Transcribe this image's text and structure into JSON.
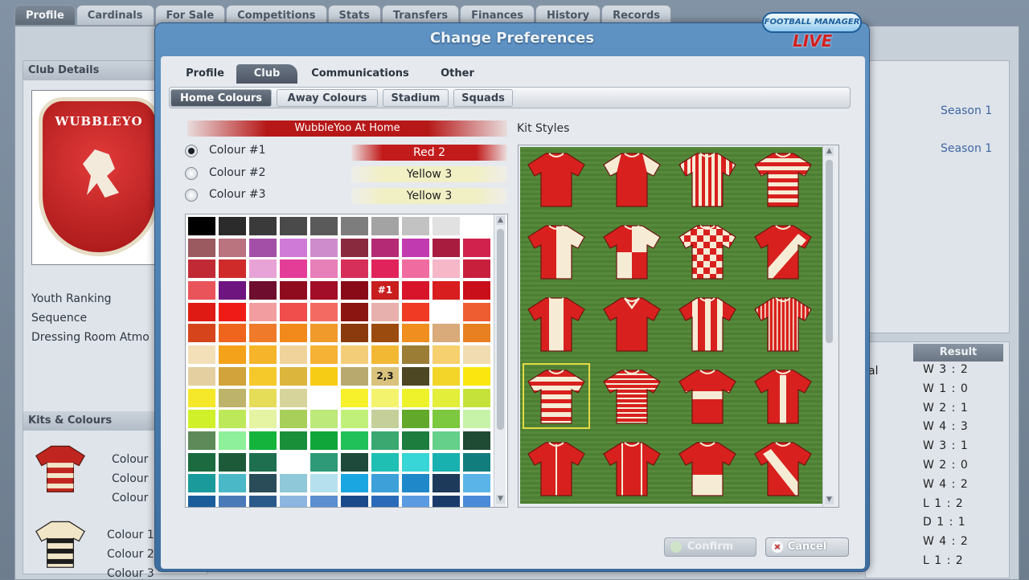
{
  "background": {
    "top_tabs": [
      "Profile",
      "Cardinals",
      "For Sale",
      "Competitions",
      "Stats",
      "Transfers",
      "Finances",
      "History",
      "Records"
    ],
    "left_panel": {
      "club_details_title": "Club Details",
      "crest_text": "WUBBLEYO",
      "labels": [
        "Youth Ranking",
        "Sequence",
        "Dressing Room Atmo"
      ],
      "kits_title": "Kits & Colours",
      "kit_colour_labels_a": [
        "Colour",
        "Colour",
        "Colour"
      ],
      "kit_colour_labels_b": [
        "Colour 1",
        "Colour 2",
        "Colour 3"
      ]
    },
    "right_panel": {
      "seasons": [
        "Season 1",
        "Season 1"
      ],
      "result_header": "Result",
      "fragment": "al",
      "results": [
        "W 3 : 2",
        "W 1 : 0",
        "W 2 : 1",
        "W 4 : 3",
        "W 3 : 1",
        "W 2 : 0",
        "W 4 : 2",
        "L 1 : 2",
        "D 1 : 1",
        "W 4 : 2",
        "L 1 : 2"
      ]
    }
  },
  "dialog": {
    "title": "Change Preferences",
    "logo": {
      "top": "FOOTBALL MANAGER",
      "bottom": "LIVE"
    },
    "tabs": [
      {
        "label": "Profile",
        "active": false
      },
      {
        "label": "Club",
        "active": true
      },
      {
        "label": "Communications",
        "active": false
      },
      {
        "label": "Other",
        "active": false
      }
    ],
    "subtabs": [
      {
        "label": "Home Colours",
        "active": true
      },
      {
        "label": "Away Colours",
        "active": false
      },
      {
        "label": "Stadium",
        "active": false
      },
      {
        "label": "Squads",
        "active": false
      }
    ],
    "kit_name": "WubbleYoo At Home",
    "colour_options": [
      {
        "label": "Colour #1",
        "value": "Red 2",
        "selected": true
      },
      {
        "label": "Colour #2",
        "value": "Yellow 3",
        "selected": false
      },
      {
        "label": "Colour #3",
        "value": "Yellow 3",
        "selected": false
      }
    ],
    "palette": [
      [
        "#000000",
        "#2b2b2b",
        "#3a3a3a",
        "#4a4a4a",
        "#5a5a5a",
        "#7d7d7d",
        "#a3a3a3",
        "#c2c2c2",
        "#e1e1e1",
        "#ffffff"
      ],
      [
        "#9a5a5f",
        "#b97480",
        "#a34fa8",
        "#d07ad8",
        "#cf8ccc",
        "#8a2a3f",
        "#b52a75",
        "#c23ab0",
        "#a81c3f",
        "#d0224c"
      ],
      [
        "#c12a35",
        "#cf2b2b",
        "#e7a2d6",
        "#e33d98",
        "#e77fb9",
        "#d62f5a",
        "#e0245b",
        "#f06ca0",
        "#f6b7c8",
        "#c81f3d"
      ],
      [
        "#e8545a",
        "#6f1580",
        "#6e0d2d",
        "#8f0c1f",
        "#a20d28",
        "#8a0b18",
        "#c81e1e",
        "#d7142a",
        "#d81e1e",
        "#c90f1a"
      ],
      [
        "#df1a14",
        "#ef1b16",
        "#f29ea0",
        "#f04d4d",
        "#f36a62",
        "#8b1510",
        "#e7b0ac",
        "#f03a24",
        "#ffffff",
        "#ee5d32"
      ],
      [
        "#d5441b",
        "#f0651d",
        "#ee7a2a",
        "#f28a1b",
        "#f09a2c",
        "#8a3a0c",
        "#9b4b0e",
        "#f08e20",
        "#d9aa7a",
        "#e87f20"
      ],
      [
        "#f3dfb8",
        "#f3a21a",
        "#f5b42a",
        "#f0d39a",
        "#f5b234",
        "#f4cd78",
        "#f2b834",
        "#9b7d35",
        "#f6cf6e",
        "#f0dcb0"
      ],
      [
        "#e3cfa0",
        "#d2a33b",
        "#f6c92a",
        "#dcb53c",
        "#f7cc15",
        "#b8aa6e",
        "#d9c27c",
        "#4d4723",
        "#f3d52a",
        "#fbe70f"
      ],
      [
        "#f5e82a",
        "#bdb36a",
        "#e5dc58",
        "#d7d49b",
        "#ffffff",
        "#f6f12b",
        "#f4f36e",
        "#eef22a",
        "#e2ee3a",
        "#c4e23a"
      ],
      [
        "#d0f02a",
        "#bde85a",
        "#e4f4a2",
        "#a9cf5b",
        "#bde87a",
        "#c1f07a",
        "#c4cf9a",
        "#62a82a",
        "#7cc83e",
        "#c6f3a7"
      ],
      [
        "#5e8a5a",
        "#8ef09a",
        "#14b43c",
        "#1a8f3a",
        "#11a63a",
        "#21c15a",
        "#3aa870",
        "#1d7d3e",
        "#64d08a",
        "#1f4a34"
      ],
      [
        "#1b6a40",
        "#1d5a3a",
        "#1d6f50",
        "#ffffff",
        "#2e9a78",
        "#1d4a3a",
        "#1fc0b3",
        "#38d6d6",
        "#19b0b0",
        "#127d7d"
      ],
      [
        "#1a9a9a",
        "#4ab8c7",
        "#2a4c58",
        "#8fc8d8",
        "#b7e0ee",
        "#1aa6e0",
        "#3da0d8",
        "#1f88c8",
        "#1e3a5a",
        "#5ab4e8"
      ],
      [
        "#1a5d9a",
        "#4a7ab8",
        "#2a5a8a",
        "#8cb6e0",
        "#5a8ed0",
        "#1a4a8a",
        "#2a6ab8",
        "#5a9ae0",
        "#1a3a6a",
        "#4a8ad8"
      ]
    ],
    "palette_marks": [
      {
        "row": 3,
        "col": 6,
        "text": "#1"
      },
      {
        "row": 7,
        "col": 6,
        "text": "2,3"
      }
    ],
    "kit_styles_label": "Kit Styles",
    "kit_colours": {
      "primary": "#d8211e",
      "secondary": "#f6ecd6"
    },
    "kits": [
      "plain",
      "sleeves",
      "stripes",
      "hoops",
      "halves-v",
      "quarters",
      "checks",
      "sash",
      "center-stripe",
      "collar-v",
      "wide-stripes",
      "pinstripes",
      "hoops-selected",
      "thin-hoops",
      "band",
      "center-bar",
      "placket",
      "side-stripes",
      "lower-band",
      "sash-white"
    ],
    "selected_kit_index": 12,
    "buttons": {
      "confirm": "Confirm",
      "cancel": "Cancel"
    }
  }
}
